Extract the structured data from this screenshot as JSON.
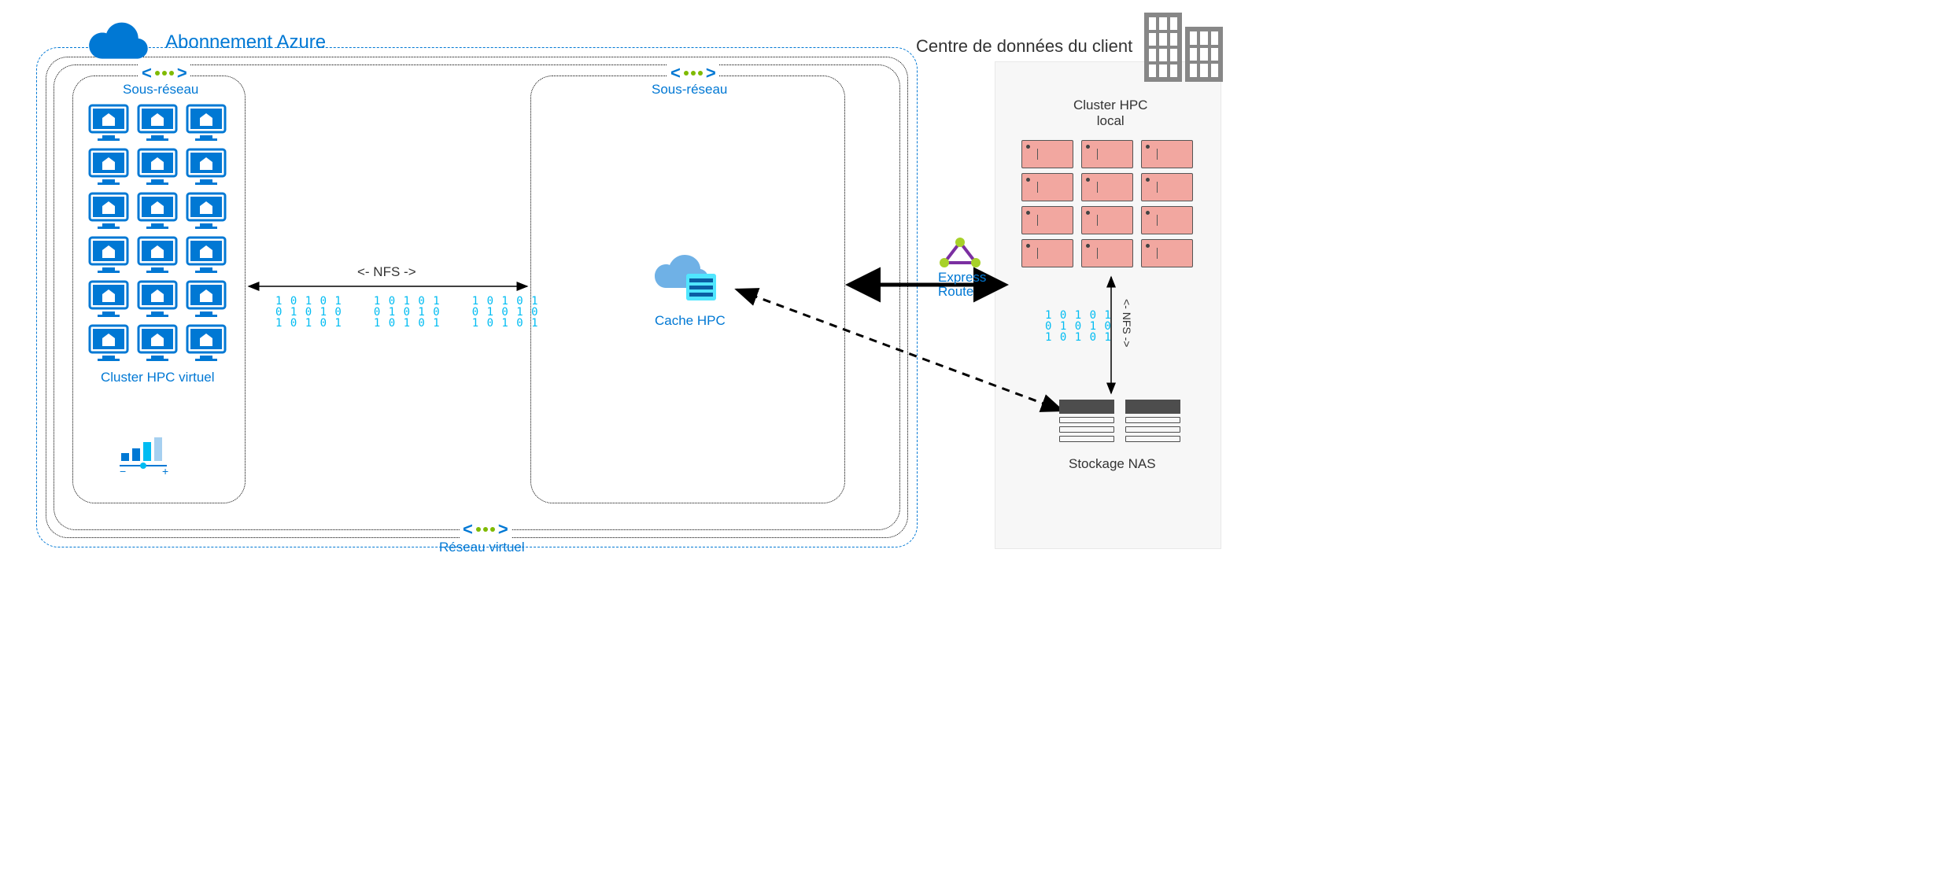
{
  "titles": {
    "azure": "Abonnement Azure",
    "datacenter": "Centre de données du client"
  },
  "labels": {
    "subnet": "Sous-réseau",
    "vnet": "Réseau virtuel",
    "cluster_virtual": "Cluster HPC virtuel",
    "cache": "Cache HPC",
    "expressroute": "Express\nRoute",
    "hpc_local": "Cluster HPC\nlocal",
    "nas": "Stockage NAS",
    "nfs": "<- NFS ->",
    "nfs_v": "<- NFS ->"
  },
  "binary": {
    "rows": [
      "1 0 1 0 1",
      "0 1 0 1 0",
      "1 0 1 0 1"
    ]
  },
  "colors": {
    "azure": "#0078d4",
    "cyan": "#00bcf2",
    "green": "#7fba00",
    "gray": "#878787",
    "red": "#f2a7a0"
  }
}
